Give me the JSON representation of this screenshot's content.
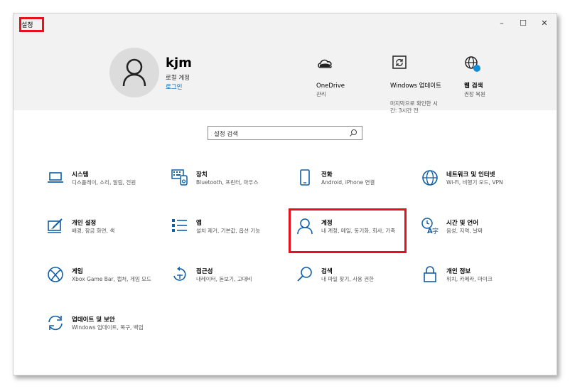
{
  "window": {
    "title": "설정",
    "min": "–",
    "max": "☐",
    "close": "✕"
  },
  "header": {
    "user_name": "kjm",
    "account_type": "로컬 계정",
    "login_link": "로그인",
    "quick": [
      {
        "title": "OneDrive",
        "sub": "관리"
      },
      {
        "title": "Windows 업데이트",
        "sub": "마지막으로 확인한 시간: 3시간 전"
      },
      {
        "title": "웹 검색",
        "sub": "권장 복원"
      }
    ]
  },
  "search": {
    "placeholder": "설정 검색"
  },
  "settings": [
    {
      "title": "시스템",
      "sub": "디스플레이, 소리, 알림, 전원",
      "icon": "laptop-icon"
    },
    {
      "title": "장치",
      "sub": "Bluetooth, 프린터, 마우스",
      "icon": "keyboard-icon"
    },
    {
      "title": "전화",
      "sub": "Android, iPhone 연결",
      "icon": "phone-icon"
    },
    {
      "title": "네트워크 및 인터넷",
      "sub": "Wi-Fi, 비행기 모드, VPN",
      "icon": "globe-icon"
    },
    {
      "title": "개인 설정",
      "sub": "배경, 잠금 화면, 색",
      "icon": "personalization-icon"
    },
    {
      "title": "앱",
      "sub": "설치 제거, 기본값, 옵션 기능",
      "icon": "apps-list-icon"
    },
    {
      "title": "계정",
      "sub": "내 계정, 메일, 동기화, 회사, 가족",
      "icon": "person-icon"
    },
    {
      "title": "시간 및 언어",
      "sub": "음성, 지역, 날짜",
      "icon": "time-language-icon"
    },
    {
      "title": "게임",
      "sub": "Xbox Game Bar, 캡처, 게임 모드",
      "icon": "xbox-icon"
    },
    {
      "title": "접근성",
      "sub": "내레이터, 돋보기, 고대비",
      "icon": "accessibility-icon"
    },
    {
      "title": "검색",
      "sub": "내 파일 찾기, 사용 권한",
      "icon": "search-icon"
    },
    {
      "title": "개인 정보",
      "sub": "위치, 카메라, 마이크",
      "icon": "lock-icon"
    },
    {
      "title": "업데이트 및 보안",
      "sub": "Windows 업데이트, 복구, 백업",
      "icon": "sync-icon"
    }
  ],
  "colors": {
    "accent": "#0067b8",
    "highlight": "#e8101c",
    "header_bg": "#f2f2f2"
  }
}
